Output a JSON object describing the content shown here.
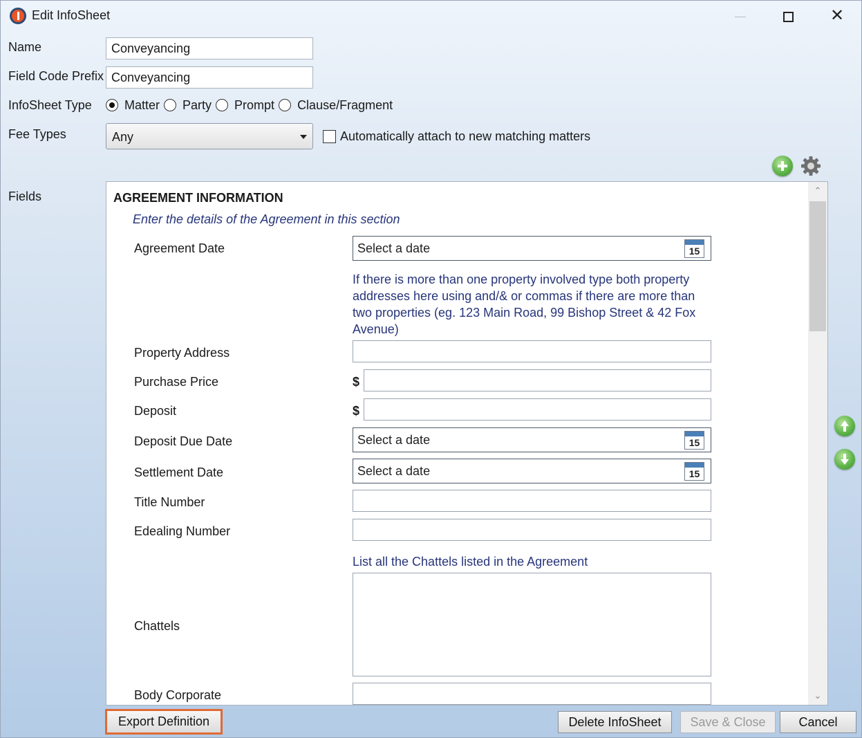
{
  "window": {
    "title": "Edit InfoSheet",
    "min_icon": "minimize-icon",
    "max_icon": "maximize-icon",
    "close_icon": "close-icon",
    "close_glyph": "✕"
  },
  "form": {
    "name_label": "Name",
    "name_value": "Conveyancing",
    "prefix_label": "Field Code Prefix",
    "prefix_value": "Conveyancing",
    "type_label": "InfoSheet Type",
    "type_options": [
      "Matter",
      "Party",
      "Prompt",
      "Clause/Fragment"
    ],
    "type_selected": "Matter",
    "fee_label": "Fee Types",
    "fee_value": "Any",
    "auto_attach_label": "Automatically attach to new matching matters",
    "auto_attach_checked": false,
    "fields_label": "Fields"
  },
  "fields_panel": {
    "section_title": "AGREEMENT INFORMATION",
    "section_desc": "Enter the details of the Agreement in this section",
    "date_placeholder": "Select a date",
    "calendar_day": "15",
    "currency": "$",
    "labels": {
      "agreement_date": "Agreement Date",
      "property_address": "Property Address",
      "purchase_price": "Purchase Price",
      "deposit": "Deposit",
      "deposit_due_date": "Deposit Due Date",
      "settlement_date": "Settlement Date",
      "title_number": "Title Number",
      "edealing_number": "Edealing Number",
      "chattels": "Chattels",
      "body_corporate": "Body Corporate"
    },
    "property_help_lines": [
      "If there is more than one property involved type both property",
      "addresses here using and/& or commas if there are more than",
      "two properties (eg. 123 Main Road, 99 Bishop Street & 42 Fox",
      "Avenue)"
    ],
    "chattels_help": "List all the Chattels listed in the Agreement",
    "scroll_up_glyph": "⌃",
    "scroll_down_glyph": "⌄"
  },
  "toolbar": {
    "add_icon": "add-field-icon",
    "settings_icon": "gear-icon",
    "move_up_icon": "move-up-icon",
    "move_down_icon": "move-down-icon"
  },
  "footer": {
    "export": "Export Definition",
    "delete": "Delete InfoSheet",
    "save": "Save & Close",
    "cancel": "Cancel"
  },
  "colors": {
    "accent_highlight": "#e06a35",
    "help_text": "#27357a",
    "icon_green": "#5fb54a"
  }
}
